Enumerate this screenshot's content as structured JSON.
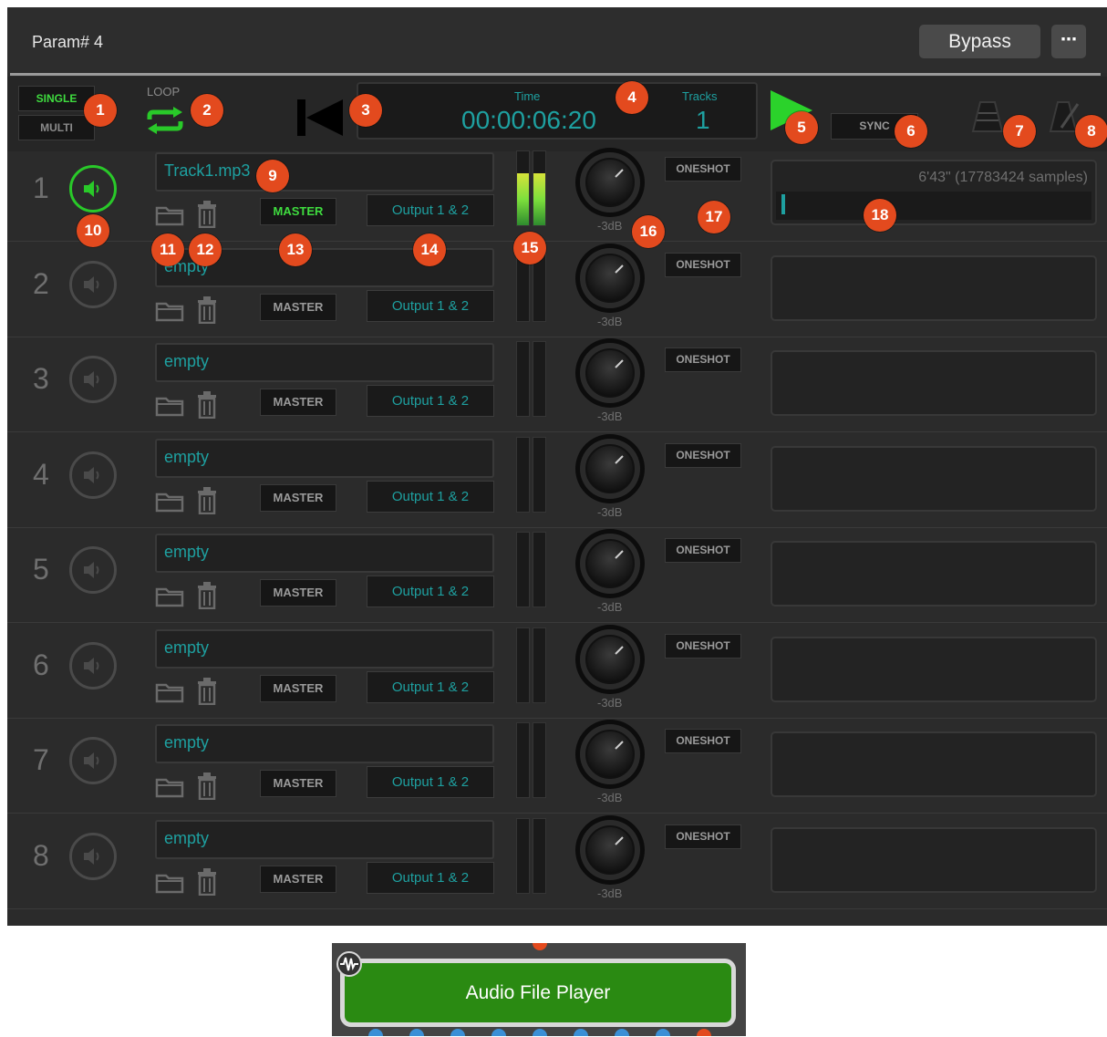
{
  "header": {
    "title": "Param# 4",
    "bypass_label": "Bypass",
    "more_label": "⋯"
  },
  "transport": {
    "single_label": "SINGLE",
    "multi_label": "MULTI",
    "loop_label": "LOOP",
    "time_label": "Time",
    "time_value": "00:00:06:20",
    "tracks_label": "Tracks",
    "tracks_value": "1",
    "sync_label": "SYNC"
  },
  "tracks": [
    {
      "num": "1",
      "file": "Track1.mp3",
      "master": "MASTER",
      "output": "Output 1 & 2",
      "db": "-3dB",
      "oneshot": "ONESHOT",
      "info": "6'43\" (17783424 samples)",
      "active": true,
      "level": 0.7
    },
    {
      "num": "2",
      "file": "empty",
      "master": "MASTER",
      "output": "Output 1 & 2",
      "db": "-3dB",
      "oneshot": "ONESHOT",
      "info": "",
      "active": false,
      "level": 0
    },
    {
      "num": "3",
      "file": "empty",
      "master": "MASTER",
      "output": "Output 1 & 2",
      "db": "-3dB",
      "oneshot": "ONESHOT",
      "info": "",
      "active": false,
      "level": 0
    },
    {
      "num": "4",
      "file": "empty",
      "master": "MASTER",
      "output": "Output 1 & 2",
      "db": "-3dB",
      "oneshot": "ONESHOT",
      "info": "",
      "active": false,
      "level": 0
    },
    {
      "num": "5",
      "file": "empty",
      "master": "MASTER",
      "output": "Output 1 & 2",
      "db": "-3dB",
      "oneshot": "ONESHOT",
      "info": "",
      "active": false,
      "level": 0
    },
    {
      "num": "6",
      "file": "empty",
      "master": "MASTER",
      "output": "Output 1 & 2",
      "db": "-3dB",
      "oneshot": "ONESHOT",
      "info": "",
      "active": false,
      "level": 0
    },
    {
      "num": "7",
      "file": "empty",
      "master": "MASTER",
      "output": "Output 1 & 2",
      "db": "-3dB",
      "oneshot": "ONESHOT",
      "info": "",
      "active": false,
      "level": 0
    },
    {
      "num": "8",
      "file": "empty",
      "master": "MASTER",
      "output": "Output 1 & 2",
      "db": "-3dB",
      "oneshot": "ONESHOT",
      "info": "",
      "active": false,
      "level": 0
    }
  ],
  "badges": [
    "1",
    "2",
    "3",
    "4",
    "5",
    "6",
    "7",
    "8",
    "9",
    "10",
    "11",
    "12",
    "13",
    "14",
    "15",
    "16",
    "17",
    "18"
  ],
  "node": {
    "label": "Audio File Player"
  },
  "colors": {
    "accent_green": "#3fdc3f",
    "teal": "#1ea0a0",
    "badge": "#e34a1e",
    "node_green": "#2a8a12"
  }
}
